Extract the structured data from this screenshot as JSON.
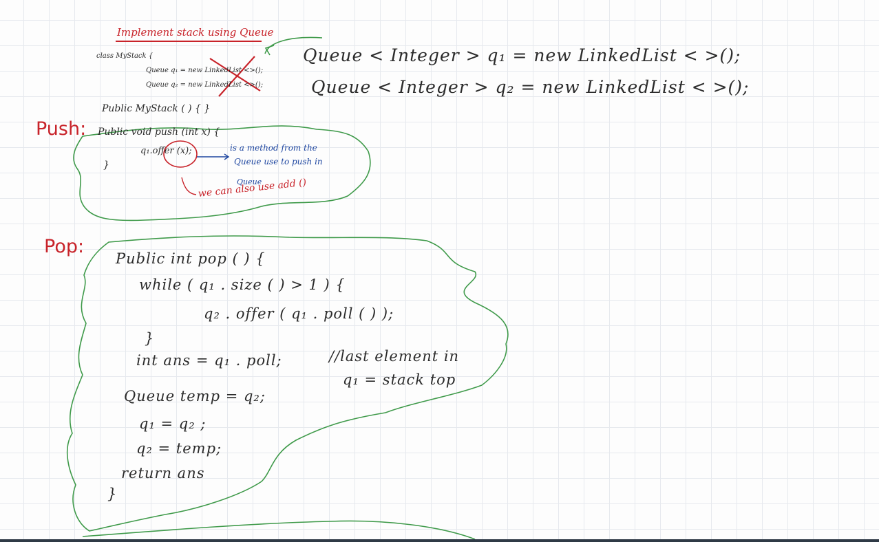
{
  "notes": {
    "title": "Implement stack using Queue",
    "class_decl": "class MyStack {",
    "queue1_old": "Queue q₁ = new LinkedList <>();",
    "queue2_old": "Queue q₂ = new LinkedList <>();",
    "queue1_new": "Queue < Integer > q₁ = new LinkedList < >();",
    "queue2_new": "Queue < Integer > q₂ = new LinkedList < >();",
    "constructor": "Public MyStack ( ) { }",
    "push_label": "Push:",
    "push_sig": "Public void push (int x) {",
    "push_body": "q₁.offer (x);",
    "push_close": "}",
    "offer_note_1": "is a method from the",
    "offer_note_2": "Queue use to push in",
    "offer_note_3": "Queue",
    "add_note": "we can also use add ()",
    "pop_label": "Pop:",
    "pop_sig": "Public int pop ( ) {",
    "while_line": "while ( q₁ . size ( ) > 1 ) {",
    "offer_line": "q₂ . offer ( q₁ . poll ( ) );",
    "while_close": "}",
    "ans_line": "int ans = q₁ . poll;",
    "comment_1": "//last element in",
    "comment_2": "q₁ = stack top",
    "temp_line": "Queue temp = q₂;",
    "swap_1": "q₁ = q₂ ;",
    "swap_2": "q₂ = temp;",
    "return_line": "return ans",
    "pop_close": "}"
  },
  "colors": {
    "ink": "#2b2b2b",
    "red": "#c8232a",
    "blue": "#1e46a0",
    "green": "#3f9a4a",
    "grid": "#e6e9ee"
  }
}
